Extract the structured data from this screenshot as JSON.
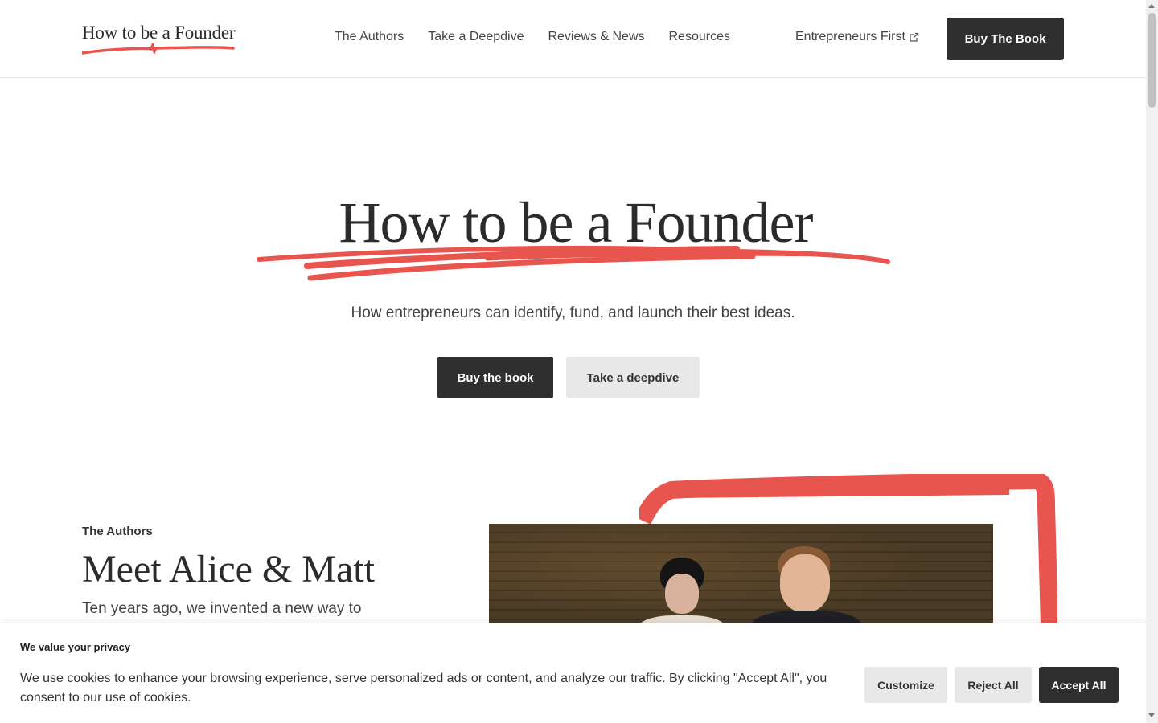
{
  "header": {
    "logo_text": "How to be a Founder",
    "nav": [
      "The Authors",
      "Take a Deepdive",
      "Reviews & News",
      "Resources"
    ],
    "external_link": "Entrepreneurs First",
    "buy_button": "Buy The Book"
  },
  "hero": {
    "title": "How to be a Founder",
    "subtitle": "How entrepreneurs can identify, fund, and launch their best ideas.",
    "primary_button": "Buy the book",
    "secondary_button": "Take a deepdive"
  },
  "authors": {
    "eyebrow": "The Authors",
    "title": "Meet Alice & Matt",
    "body": "Ten years ago, we invented a new way to"
  },
  "cookie_banner": {
    "title": "We value your privacy",
    "text": "We use cookies to enhance your browsing experience, serve personalized ads or content, and analyze our traffic. By clicking \"Accept All\", you consent to our use of cookies.",
    "customize": "Customize",
    "reject": "Reject All",
    "accept": "Accept All"
  },
  "colors": {
    "accent": "#e8554e",
    "dark": "#2f2f2f",
    "light_button": "#e8e8e8"
  }
}
